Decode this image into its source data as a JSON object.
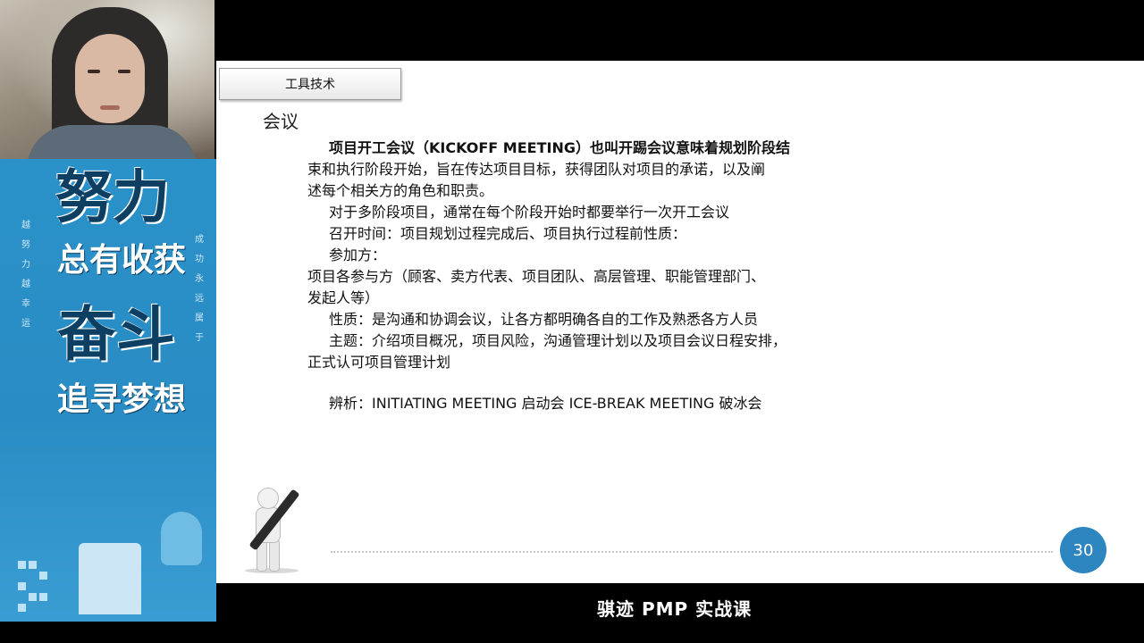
{
  "slide": {
    "section_tab": "工具技术",
    "title": "会议",
    "paragraphs": [
      "项目开工会议（KICKOFF MEETING）也叫开踢会议意味着规划阶段结",
      "束和执行阶段开始，旨在传达项目目标，获得团队对项目的承诺，以及阐",
      "述每个相关方的角色和职责。",
      "对于多阶段项目，通常在每个阶段开始时都要举行一次开工会议",
      "召开时间：项目规划过程完成后、项目执行过程前性质：",
      "参加方：",
      "项目各参与方（顾客、卖方代表、项目团队、高层管理、职能管理部门、",
      "发起人等）",
      "性质：是沟通和协调会议，让各方都明确各自的工作及熟悉各方人员",
      "主题：介绍项目概况，项目风险，沟通管理计划以及项目会议日程安排，",
      "正式认可项目管理计划",
      "辨析：INITIATING MEETING 启动会   ICE-BREAK MEETING 破冰会"
    ],
    "page_number": "30"
  },
  "poster": {
    "line1": "努力",
    "line2": "总有收获",
    "line3": "奋斗",
    "line4": "追寻梦想",
    "left_vertical": "越努力越幸运",
    "right_vertical": "成功永远属于"
  },
  "subtitle": "骐迹 PMP 实战课"
}
